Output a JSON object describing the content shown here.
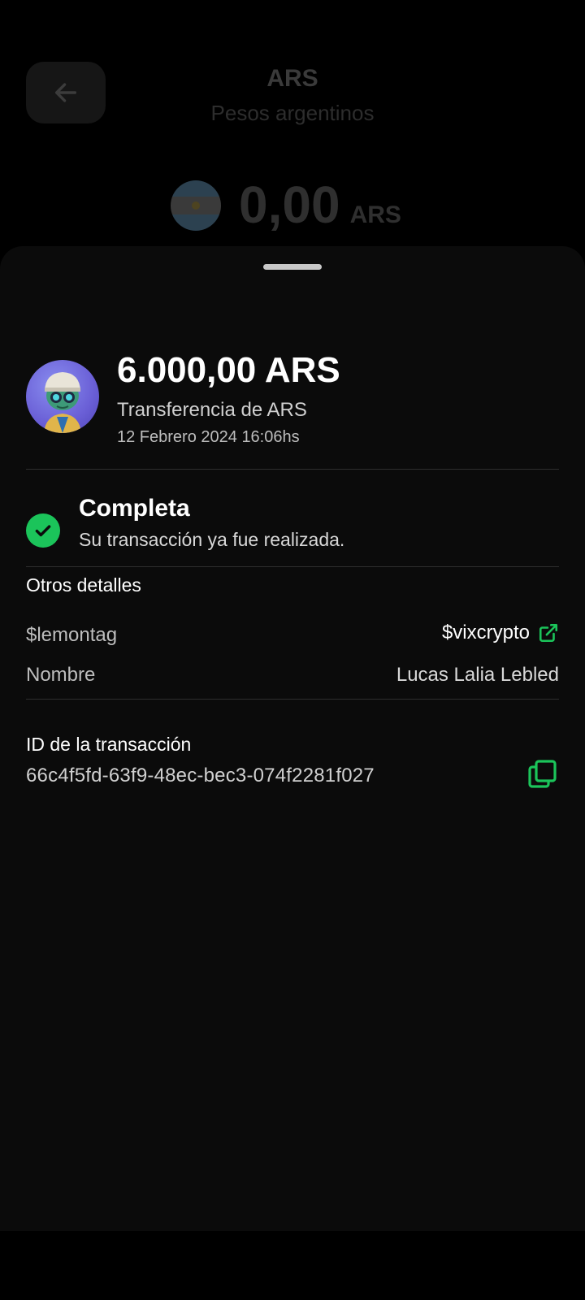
{
  "header": {
    "title": "ARS",
    "subtitle": "Pesos argentinos",
    "balance_amount": "0,00",
    "balance_currency": "ARS"
  },
  "transaction": {
    "amount": "6.000,00 ARS",
    "type": "Transferencia de ARS",
    "date": "12 Febrero 2024 16:06hs"
  },
  "status": {
    "title": "Completa",
    "description": "Su transacción ya fue realizada."
  },
  "details": {
    "section_title": "Otros detalles",
    "lemontag_label": "$lemontag",
    "lemontag_value": "$vixcrypto",
    "name_label": "Nombre",
    "name_value": "Lucas Lalia Lebled",
    "txid_label": "ID de la transacción",
    "txid_value": "66c4f5fd-63f9-48ec-bec3-074f2281f027"
  },
  "colors": {
    "accent_green": "#1bc45a",
    "sheet_bg": "#0b0b0b"
  },
  "icons": {
    "back": "arrow-left-icon",
    "status": "check-circle-icon",
    "external_link": "external-link-icon",
    "copy": "copy-icon"
  }
}
